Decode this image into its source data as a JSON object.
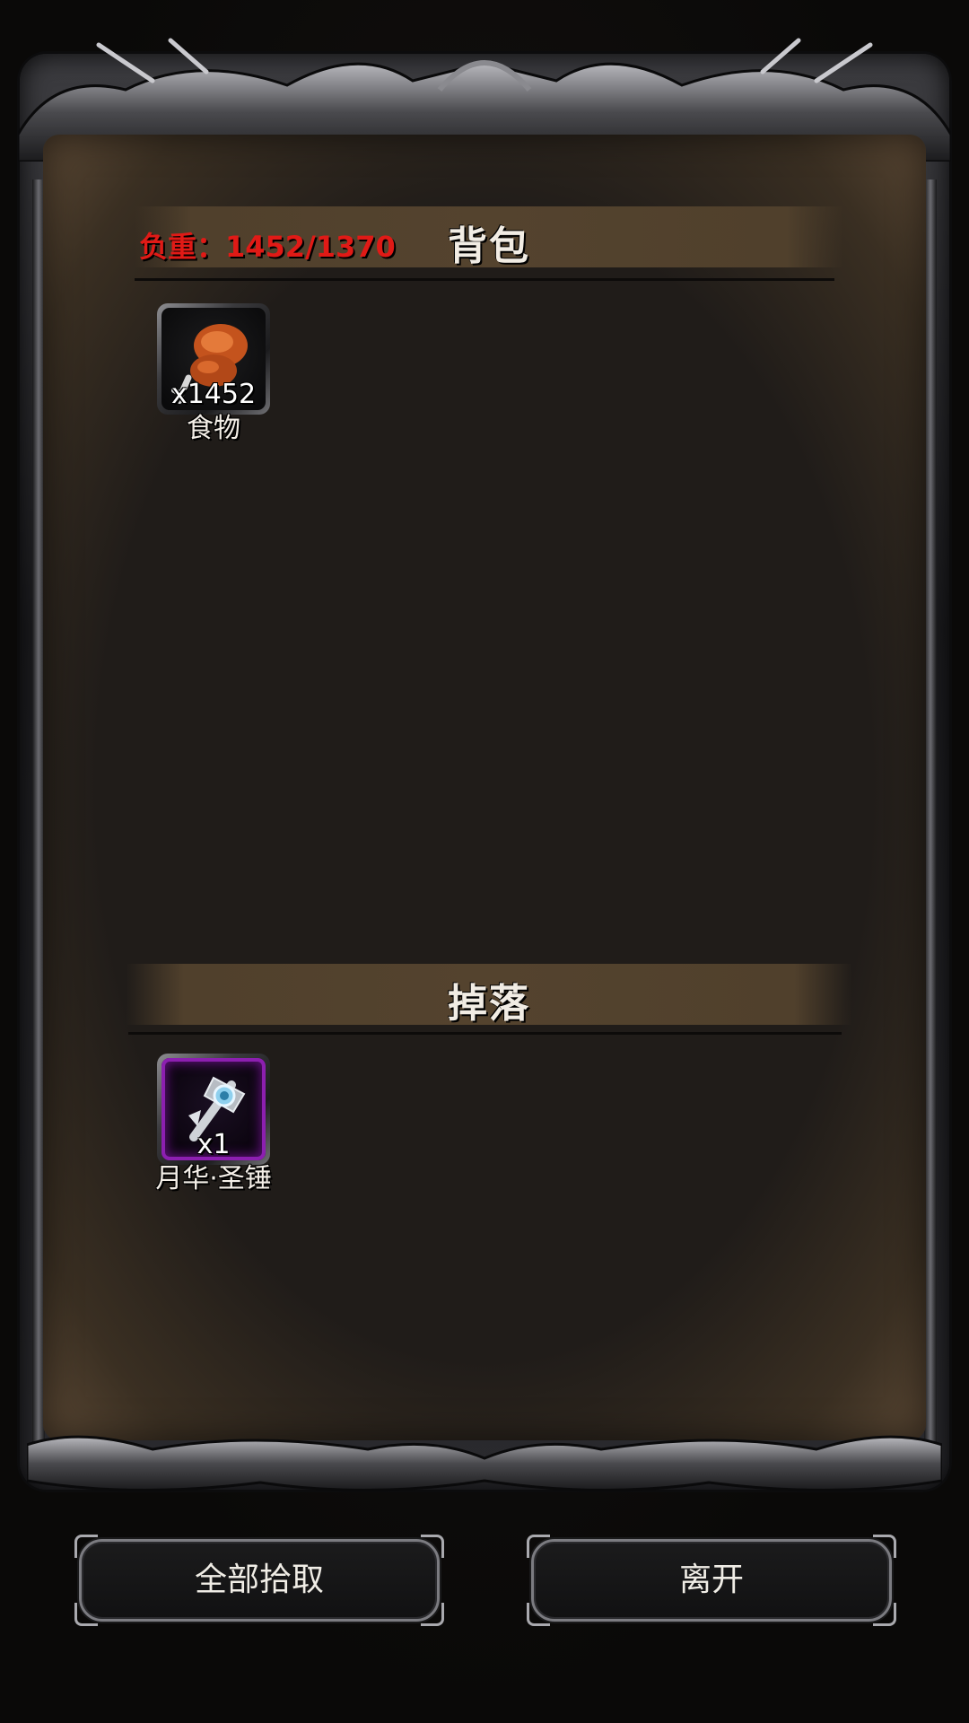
{
  "backpack": {
    "weight_text": "负重：1452/1370",
    "title": "背包",
    "items": [
      {
        "name": "食物",
        "count": "x1452",
        "icon": "meat-drumstick-icon"
      }
    ]
  },
  "drops": {
    "title": "掉落",
    "items": [
      {
        "name": "月华·圣锤",
        "count": "x1",
        "icon": "holy-hammer-icon",
        "rarity_color": "#8c1fb0"
      }
    ]
  },
  "buttons": {
    "pickup_all": "全部拾取",
    "leave": "离开"
  },
  "colors": {
    "weight_warning": "#e01a16",
    "banner": "#54432e",
    "panel": "#201c19"
  }
}
